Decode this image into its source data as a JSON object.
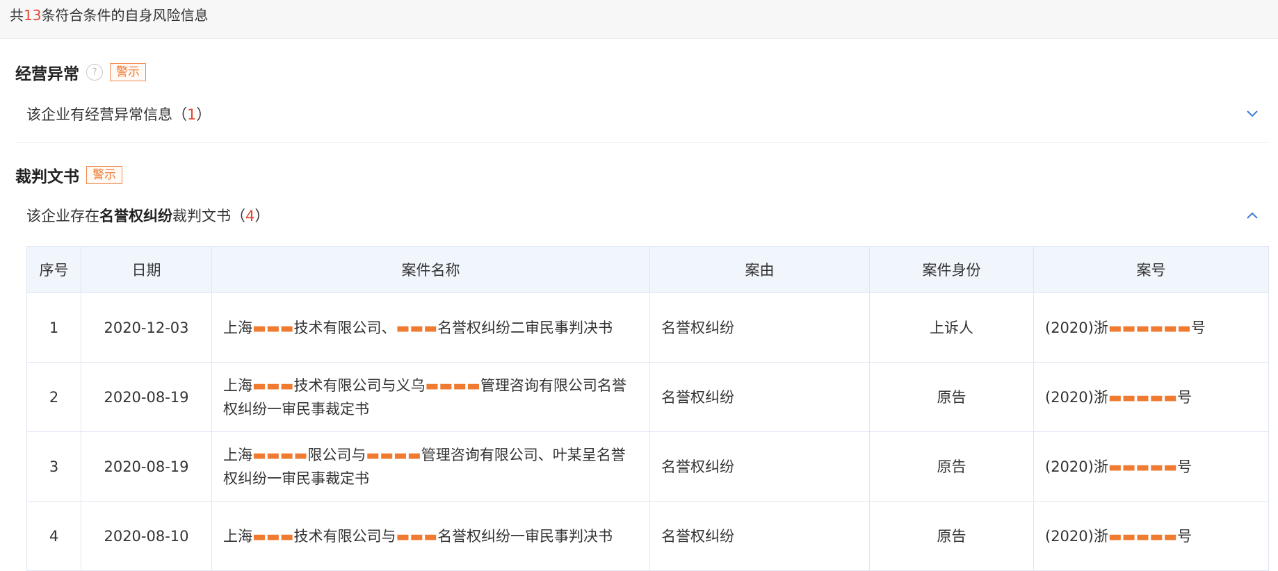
{
  "summary": {
    "prefix": "共",
    "count": "13",
    "suffix": "条符合条件的自身风险信息"
  },
  "sections": {
    "abnormal": {
      "title": "经营异常",
      "help_icon": "question-circle-icon",
      "badge": "警示",
      "row_text": "该企业有经营异常信息（",
      "row_count": "1",
      "row_close": "）",
      "toggle_icon": "chevron-down-icon"
    },
    "judgments": {
      "title": "裁判文书",
      "badge": "警示",
      "row_prefix": "该企业存在",
      "row_bold": "名誉权纠纷",
      "row_suffix": "裁判文书（",
      "row_count": "4",
      "row_close": "）",
      "toggle_icon": "chevron-up-icon"
    }
  },
  "table": {
    "headers": [
      "序号",
      "日期",
      "案件名称",
      "案由",
      "案件身份",
      "案号"
    ],
    "rows": [
      {
        "index": "1",
        "date": "2020-12-03",
        "name_a": "上海",
        "name_b": "技术有限公司、",
        "name_c": "名誉权纠纷二审民事判决书",
        "cause": "名誉权纠纷",
        "role": "上诉人",
        "case_no_a": "(2020)浙",
        "case_no_b": "号"
      },
      {
        "index": "2",
        "date": "2020-08-19",
        "name_a": "上海",
        "name_b": "技术有限公司与义乌",
        "name_c": "管理咨询有限公司名誉权纠纷一审民事裁定书",
        "cause": "名誉权纠纷",
        "role": "原告",
        "case_no_a": "(2020)浙",
        "case_no_b": "号"
      },
      {
        "index": "3",
        "date": "2020-08-19",
        "name_a": "上海",
        "name_b": "限公司与",
        "name_c": "管理咨询有限公司、叶某呈名誉权纠纷一审民事裁定书",
        "cause": "名誉权纠纷",
        "role": "原告",
        "case_no_a": "(2020)浙",
        "case_no_b": "号"
      },
      {
        "index": "4",
        "date": "2020-08-10",
        "name_a": "上海",
        "name_b": "技术有限公司与",
        "name_c": "名誉权纠纷一审民事判决书",
        "cause": "名誉权纠纷",
        "role": "原告",
        "case_no_a": "(2020)浙",
        "case_no_b": "号"
      }
    ]
  },
  "colors": {
    "accent_red": "#e4492f",
    "link_blue": "#2f7ad6",
    "warn_orange": "#f0782f",
    "header_bg": "#f1f5fc"
  }
}
